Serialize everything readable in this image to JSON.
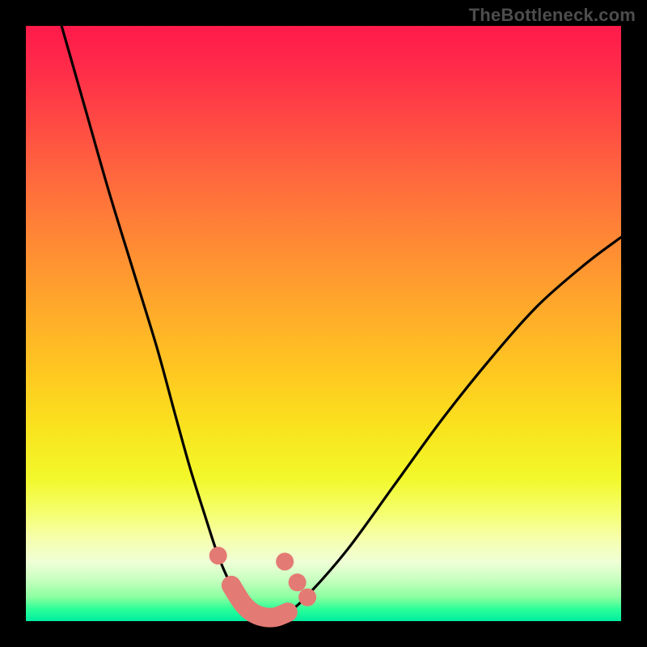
{
  "watermark": "TheBottleneck.com",
  "colors": {
    "marker": "#e47a74",
    "curve": "#000000",
    "frame": "#000000"
  },
  "chart_data": {
    "type": "line",
    "title": "",
    "xlabel": "",
    "ylabel": "",
    "xlim": [
      0,
      100
    ],
    "ylim": [
      0,
      100
    ],
    "grid": false,
    "legend": false,
    "series": [
      {
        "name": "bottleneck-curve",
        "x": [
          6,
          10,
          14,
          18,
          22,
          25,
          27.5,
          30,
          32.3,
          34.5,
          36.4,
          38,
          40,
          42,
          44,
          47,
          54,
          62,
          70,
          78,
          86,
          94,
          100
        ],
        "y": [
          100,
          86,
          72,
          59,
          46,
          35,
          26,
          18,
          11,
          6,
          3,
          1.5,
          0.7,
          0.7,
          1.5,
          4,
          12,
          23,
          34,
          44,
          53,
          60,
          64.5
        ]
      }
    ],
    "markers": [
      {
        "name": "point-a",
        "x": 32.3,
        "y": 11
      },
      {
        "name": "point-b",
        "x": 43.5,
        "y": 10
      },
      {
        "name": "point-c",
        "x": 45.6,
        "y": 6.5
      },
      {
        "name": "point-d",
        "x": 47.3,
        "y": 4
      }
    ],
    "highlight_segment": {
      "name": "optimal-range",
      "path_x": [
        34.5,
        36.4,
        38,
        40,
        42,
        44
      ],
      "path_y": [
        6,
        3,
        1.5,
        0.7,
        0.7,
        1.5
      ]
    }
  }
}
